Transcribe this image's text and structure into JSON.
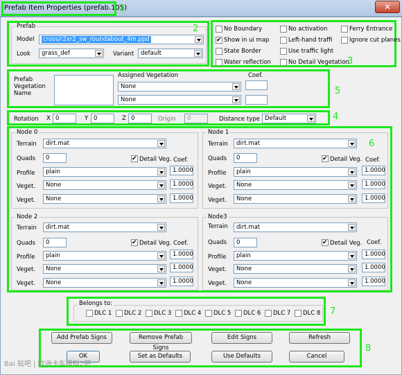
{
  "window": {
    "title": "Prefab Item Properties (prefab.105)",
    "close_glyph": "✕"
  },
  "annotations": [
    "1",
    "2",
    "3",
    "4",
    "5",
    "6",
    "7",
    "8"
  ],
  "prefab": {
    "group_label": "Prefab",
    "model_label": "Model",
    "model_value": "cross/r2xr2_sw_roundabout_4m.ppd",
    "look_label": "Look",
    "look_value": "grass_def",
    "variant_label": "Variant",
    "variant_value": "default"
  },
  "flags": [
    {
      "label": "No Boundary",
      "checked": false
    },
    {
      "label": "No activation",
      "checked": false
    },
    {
      "label": "Ferry Entrance",
      "checked": false
    },
    {
      "label": "Show in ui map",
      "checked": true
    },
    {
      "label": "Left-hand traffi",
      "checked": false
    },
    {
      "label": "Ignore cut planes",
      "checked": false
    },
    {
      "label": "State Border",
      "checked": false
    },
    {
      "label": "Use traffic light",
      "checked": false
    },
    {
      "label": "Water reflection",
      "checked": false
    },
    {
      "label": "No Detail Vegetation",
      "checked": false
    }
  ],
  "vegetation": {
    "name_label_1": "Prefab",
    "name_label_2": "Vegetation",
    "name_label_3": "Name",
    "assigned_label": "Assigned Vegetation",
    "coef_label": "Coef.",
    "veg1": "None",
    "veg2": "None"
  },
  "transform": {
    "rotation_label": "Rotation",
    "x_label": "X",
    "x_value": "0",
    "y_label": "Y",
    "y_value": "0",
    "z_label": "Z",
    "z_value": "0",
    "origin_label": "Origin",
    "origin_value": "0",
    "distance_label": "Distance type",
    "distance_value": "Default"
  },
  "nodes": {
    "labels": {
      "terrain": "Terrain",
      "quads": "Quads",
      "profile": "Profile",
      "veget": "Veget.",
      "detail": "Detail Veg.",
      "coef": "Coef."
    },
    "n0": {
      "title": "Node 0",
      "terrain": "dirt.mat",
      "quads": "0",
      "profile": "plain",
      "profile_coef": "1.00000",
      "veg1": "None",
      "veg1_coef": "1.00000",
      "veg2": "None",
      "veg2_coef": "1.00000"
    },
    "n1": {
      "title": "Node 1",
      "terrain": "dirt.mat",
      "quads": "0",
      "profile": "plain",
      "profile_coef": "1.00000",
      "veg1": "None",
      "veg1_coef": "1.00000",
      "veg2": "None",
      "veg2_coef": "1.00000"
    },
    "n2": {
      "title": "Node 2",
      "terrain": "dirt.mat",
      "quads": "0",
      "profile": "plain",
      "profile_coef": "1.00000",
      "veg1": "None",
      "veg1_coef": "1.00000",
      "veg2": "None",
      "veg2_coef": "1.00000"
    },
    "n3": {
      "title": "Node3",
      "terrain": "dirt.mat",
      "quads": "0",
      "profile": "plain",
      "profile_coef": "1.00000",
      "veg1": "None",
      "veg1_coef": "1.00000",
      "veg2": "None",
      "veg2_coef": "1.00000"
    }
  },
  "belongs": {
    "label": "Belongs to:",
    "dlcs": [
      "DLC 1",
      "DLC 2",
      "DLC 3",
      "DLC 4",
      "DLC 5",
      "DLC 6",
      "DLC 7",
      "DLC 8"
    ]
  },
  "buttons": {
    "add_signs": "Add Prefab Signs",
    "remove_signs": "Remove Prefab Signs",
    "edit_signs": "Edit Signs",
    "refresh": "Refresh",
    "ok": "OK",
    "set_defaults": "Set as Defaults",
    "use_defaults": "Use Defaults",
    "cancel": "Cancel"
  },
  "watermark": "Bai 贴吧 | 欧洲卡车模拟2吧"
}
